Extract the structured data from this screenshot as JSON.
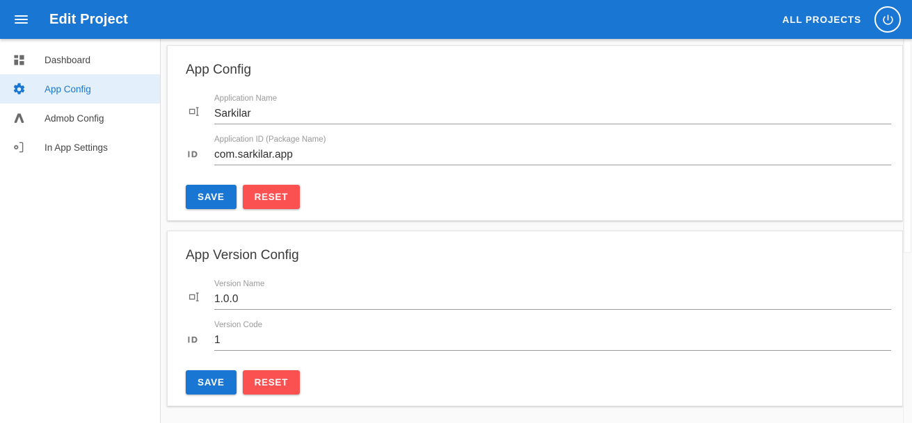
{
  "appbar": {
    "menu_icon": "hamburger-menu-icon",
    "title": "Edit Project",
    "all_projects_label": "ALL PROJECTS",
    "power_icon": "power-icon",
    "background_color": "#1976d2"
  },
  "sidebar": {
    "items": [
      {
        "label": "Dashboard",
        "icon": "dashboard-icon",
        "active": false
      },
      {
        "label": "App Config",
        "icon": "gear-icon",
        "active": true
      },
      {
        "label": "Admob Config",
        "icon": "admob-icon",
        "active": false
      },
      {
        "label": "In App Settings",
        "icon": "phone-settings-icon",
        "active": false
      }
    ],
    "active_color": "#1976d2",
    "active_background": "#e3f0fb"
  },
  "cards": [
    {
      "title": "App Config",
      "fields": [
        {
          "icon": "title-icon",
          "label": "Application Name",
          "value": "Sarkilar",
          "placeholder": "Application Name"
        },
        {
          "icon": "id-icon",
          "label": "Application ID (Package Name)",
          "value": "com.sarkilar.app",
          "placeholder": "Application ID (Package Name)"
        }
      ],
      "save_label": "SAVE",
      "reset_label": "RESET"
    },
    {
      "title": "App Version Config",
      "fields": [
        {
          "icon": "title-icon",
          "label": "Version Name",
          "value": "1.0.0",
          "placeholder": "Version Name"
        },
        {
          "icon": "id-icon",
          "label": "Version Code",
          "value": "1",
          "placeholder": "Version Code"
        }
      ],
      "save_label": "SAVE",
      "reset_label": "RESET"
    }
  ],
  "colors": {
    "primary": "#1976d2",
    "danger": "#fb5151",
    "page_background": "#fafafa",
    "card_background": "#ffffff"
  }
}
